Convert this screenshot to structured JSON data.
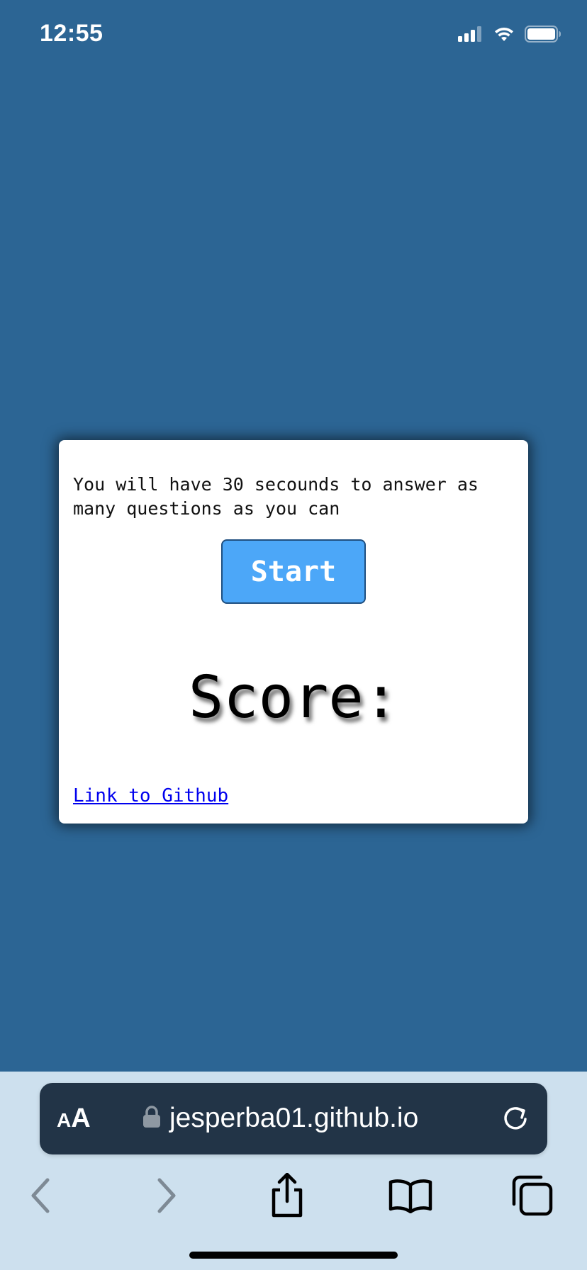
{
  "status_bar": {
    "time": "12:55",
    "icons": [
      "cellular-signal-icon",
      "wifi-icon",
      "battery-icon"
    ]
  },
  "card": {
    "instructions": "You will have 30 secounds to answer as many questions as you can",
    "start_label": "Start",
    "score_label": "Score:",
    "github_link": "Link to Github"
  },
  "browser": {
    "text_size_label_small": "A",
    "text_size_label_big": "A",
    "url": "jesperba01.github.io",
    "icons": [
      "lock-icon",
      "reload-icon",
      "back-icon",
      "forward-icon",
      "share-icon",
      "bookmarks-icon",
      "tabs-icon"
    ]
  },
  "colors": {
    "page_background": "#2c6594",
    "card_background": "#ffffff",
    "start_button": "#4ca7f8",
    "link": "#0000ee",
    "address_bar": "#223447",
    "toolbar": "#cde0ee"
  }
}
